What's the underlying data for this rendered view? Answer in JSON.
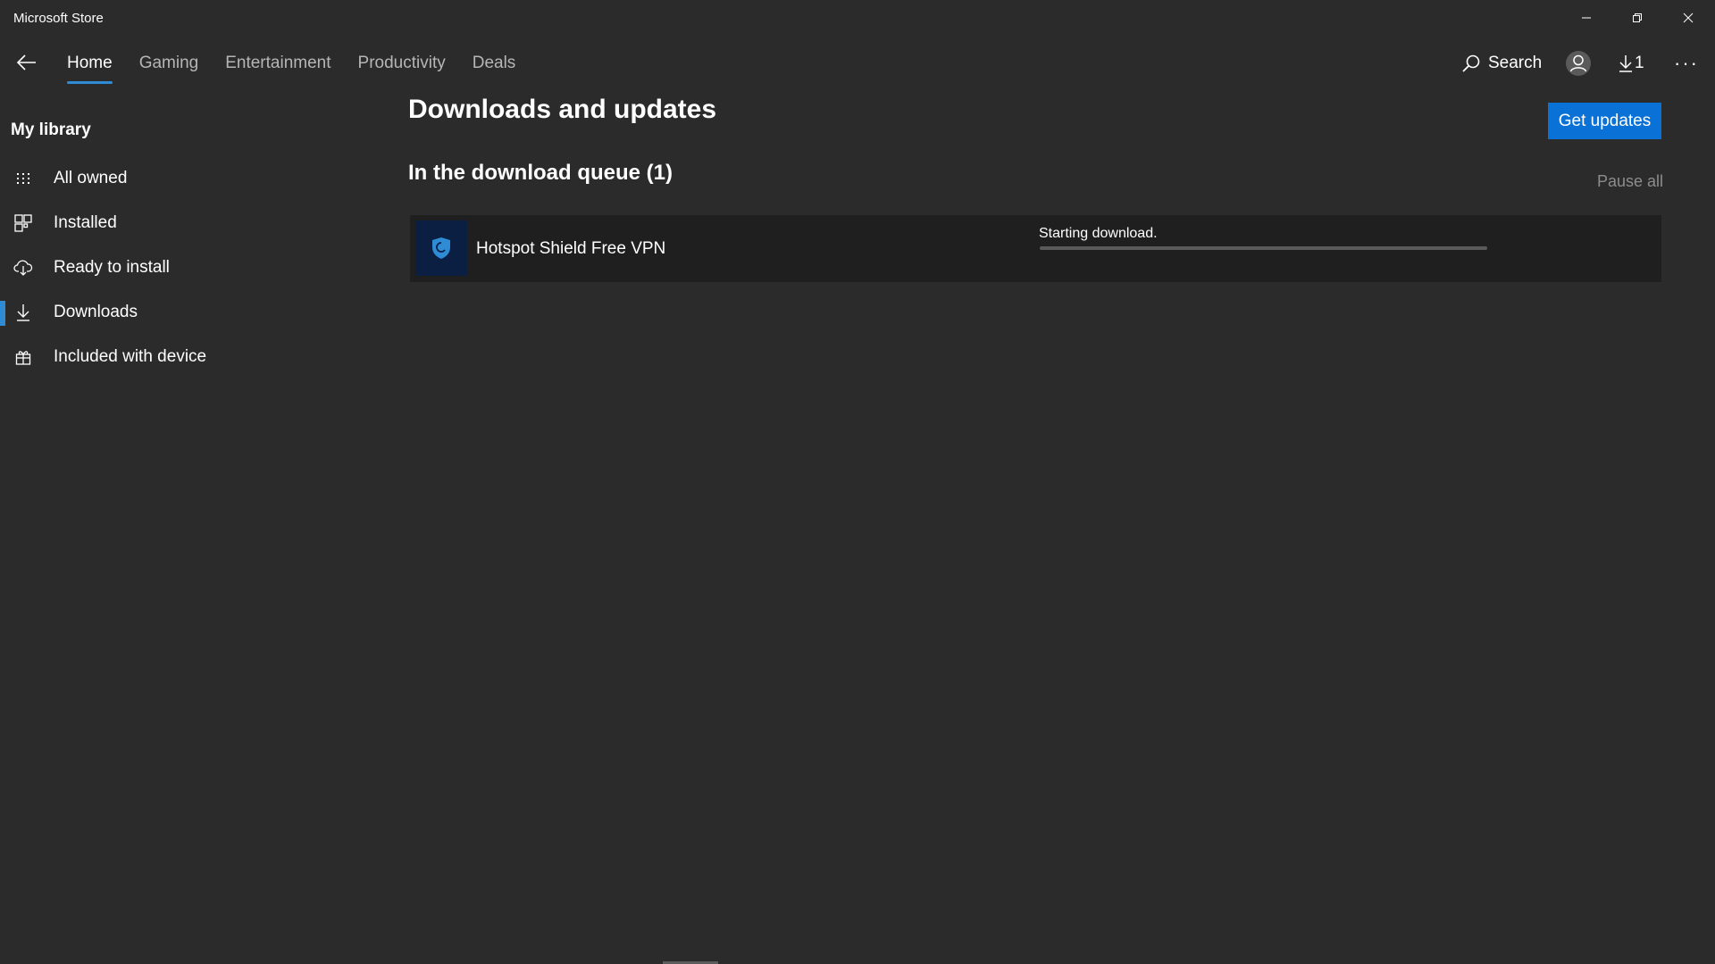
{
  "window": {
    "title": "Microsoft Store",
    "icons": {
      "minimize": "minimize-icon",
      "maximize": "restore-icon",
      "close": "close-icon"
    }
  },
  "nav": {
    "back_icon": "back-arrow-icon",
    "tabs": [
      {
        "label": "Home",
        "active": true
      },
      {
        "label": "Gaming",
        "active": false
      },
      {
        "label": "Entertainment",
        "active": false
      },
      {
        "label": "Productivity",
        "active": false
      },
      {
        "label": "Deals",
        "active": false
      }
    ],
    "search_label": "Search",
    "downloads_count": "1",
    "more_label": "···"
  },
  "sidebar": {
    "heading": "My library",
    "items": [
      {
        "label": "All owned",
        "icon": "grid-icon",
        "active": false
      },
      {
        "label": "Installed",
        "icon": "installed-grid-icon",
        "active": false
      },
      {
        "label": "Ready to install",
        "icon": "cloud-download-icon",
        "active": false
      },
      {
        "label": "Downloads",
        "icon": "download-icon",
        "active": true
      },
      {
        "label": "Included with device",
        "icon": "gift-icon",
        "active": false
      }
    ]
  },
  "main": {
    "title": "Downloads and updates",
    "get_updates_label": "Get updates",
    "queue_title": "In the download queue (1)",
    "pause_all_label": "Pause all",
    "queue": [
      {
        "app_name": "Hotspot Shield Free VPN",
        "icon": "shield-icon",
        "status": "Starting download.",
        "progress": 0
      }
    ]
  },
  "colors": {
    "background": "#2b2b2b",
    "row_background": "#1f1f1f",
    "accent": "#0a72d6",
    "tab_indicator": "#2e8bd4",
    "muted_text": "#8d8d8d"
  }
}
